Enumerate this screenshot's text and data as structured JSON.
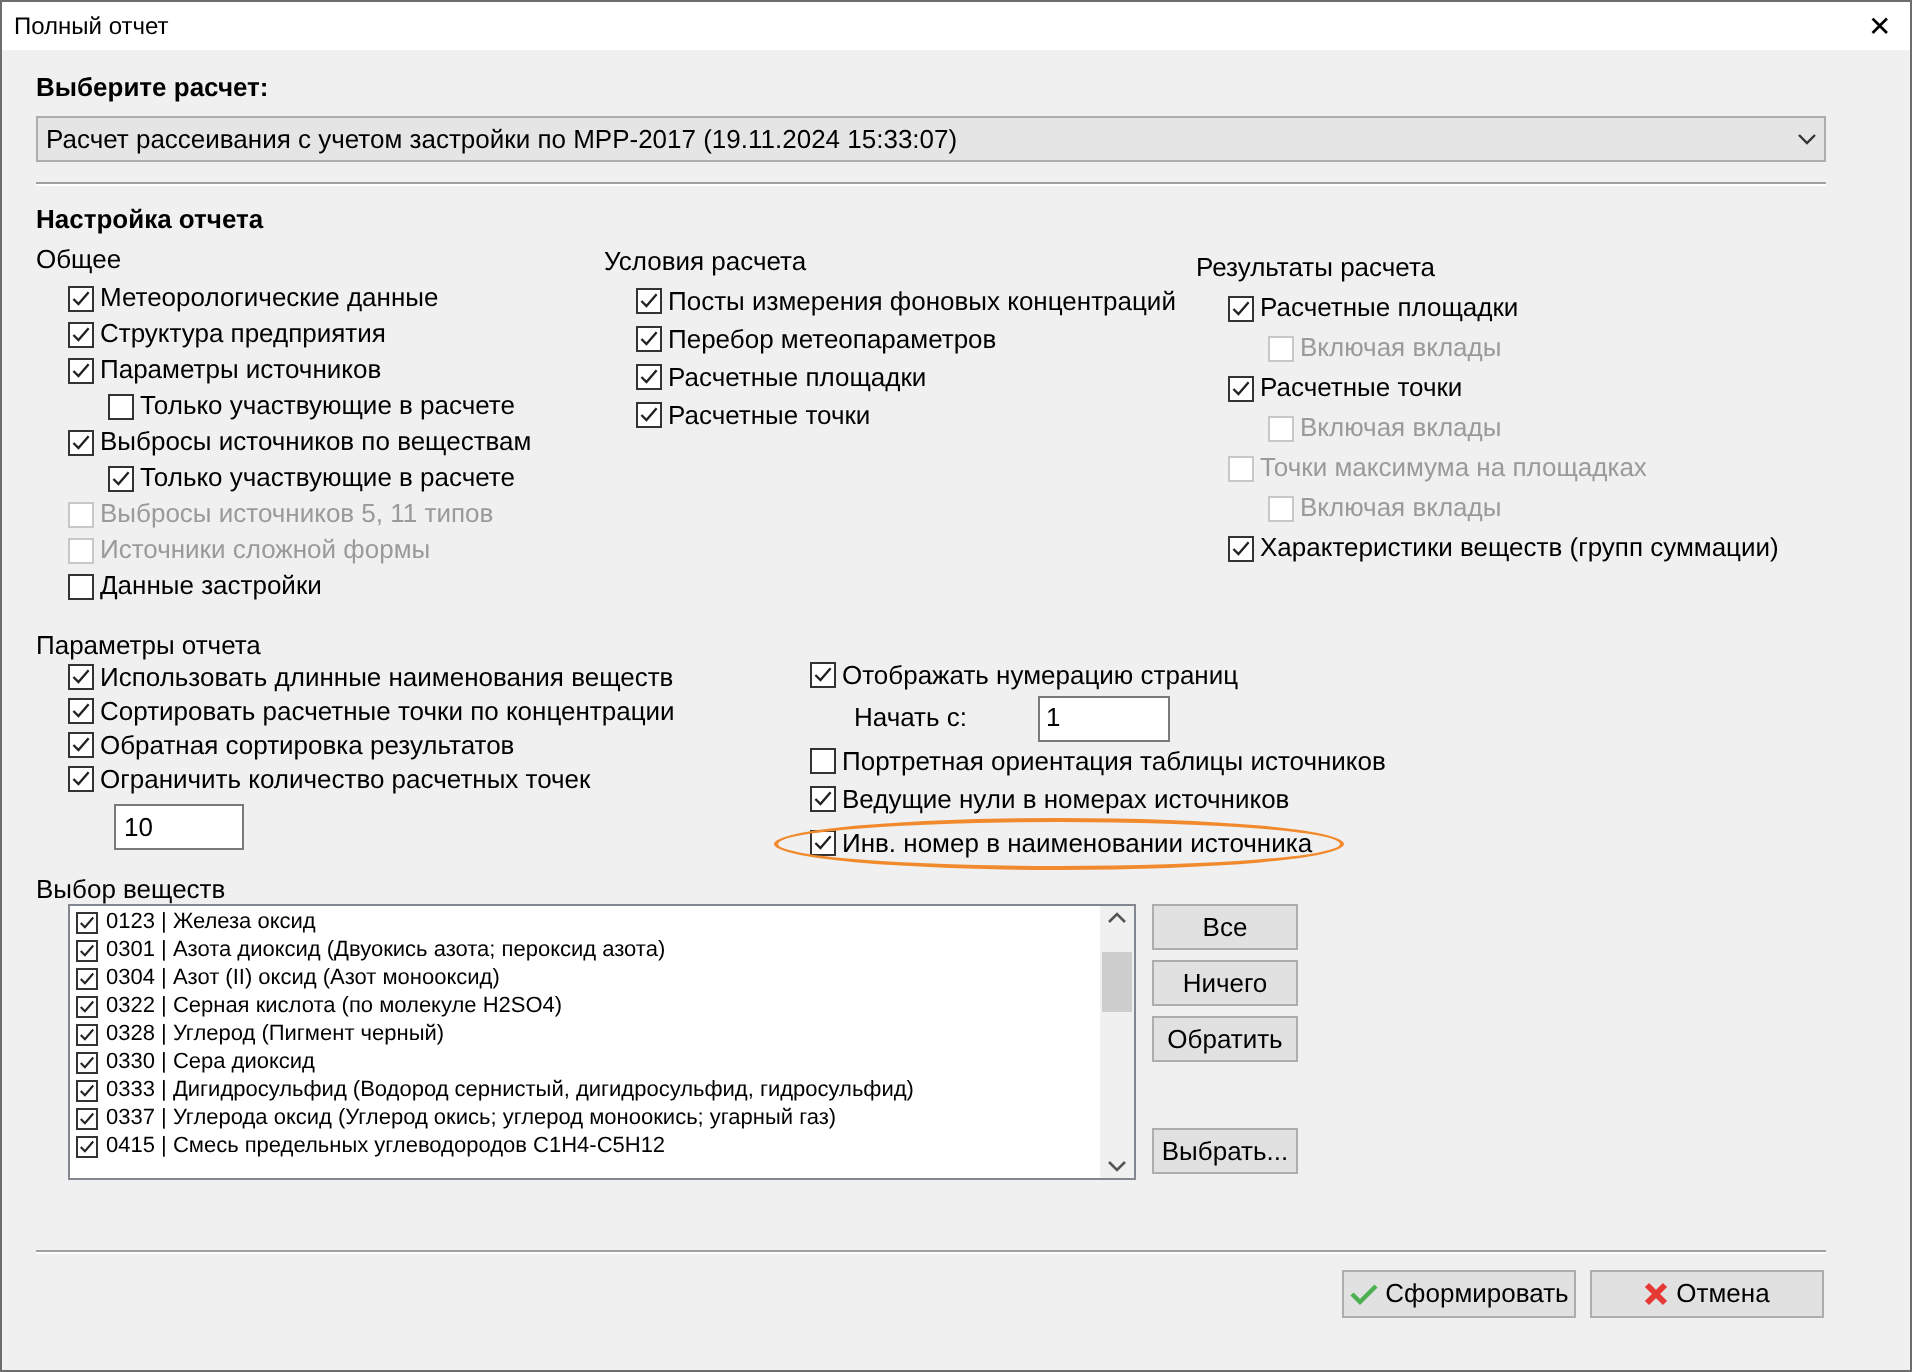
{
  "window": {
    "title": "Полный отчет",
    "close": "✕"
  },
  "calculation": {
    "label": "Выберите расчет:",
    "value": "Расчет рассеивания с учетом застройки по МРР-2017 (19.11.2024 15:33:07)"
  },
  "report_settings": {
    "title": "Настройка отчета",
    "groups": [
      {
        "title": "Общее",
        "items": [
          {
            "label": "Метеорологические данные",
            "checked": true,
            "disabled": false
          },
          {
            "label": "Структура предприятия",
            "checked": true,
            "disabled": false
          },
          {
            "label": "Параметры источников",
            "checked": true,
            "disabled": false,
            "children": [
              {
                "label": "Только участвующие в расчете",
                "checked": false,
                "disabled": false
              }
            ]
          },
          {
            "label": "Выбросы источников по веществам",
            "checked": true,
            "disabled": false,
            "children": [
              {
                "label": "Только участвующие в расчете",
                "checked": true,
                "disabled": false
              }
            ]
          },
          {
            "label": "Выбросы источников 5, 11 типов",
            "checked": false,
            "disabled": true
          },
          {
            "label": "Источники сложной формы",
            "checked": false,
            "disabled": true
          },
          {
            "label": "Данные застройки",
            "checked": false,
            "disabled": false
          }
        ]
      },
      {
        "title": "Условия расчета",
        "items": [
          {
            "label": "Посты измерения фоновых концентраций",
            "checked": true,
            "disabled": false
          },
          {
            "label": "Перебор метеопараметров",
            "checked": true,
            "disabled": false
          },
          {
            "label": "Расчетные площадки",
            "checked": true,
            "disabled": false
          },
          {
            "label": "Расчетные точки",
            "checked": true,
            "disabled": false
          }
        ]
      },
      {
        "title": "Результаты расчета",
        "items": [
          {
            "label": "Расчетные площадки",
            "checked": true,
            "disabled": false,
            "children": [
              {
                "label": "Включая вклады",
                "checked": false,
                "disabled": true
              }
            ]
          },
          {
            "label": "Расчетные точки",
            "checked": true,
            "disabled": false,
            "children": [
              {
                "label": "Включая вклады",
                "checked": false,
                "disabled": true
              }
            ]
          },
          {
            "label": "Точки максимума на площадках",
            "checked": false,
            "disabled": true,
            "children": [
              {
                "label": "Включая вклады",
                "checked": false,
                "disabled": true
              }
            ]
          },
          {
            "label": "Характеристики  веществ (групп суммации)",
            "checked": true,
            "disabled": false
          }
        ]
      }
    ]
  },
  "report_parameters": {
    "title": "Параметры отчета",
    "left_items": [
      {
        "kind": "checkbox",
        "label": "Использовать длинные наименования веществ",
        "checked": true
      },
      {
        "kind": "checkbox",
        "label": "Сортировать расчетные точки по концентрации",
        "checked": true
      },
      {
        "kind": "checkbox",
        "label": "Обратная сортировка результатов",
        "checked": true
      },
      {
        "kind": "checkbox",
        "label": "Ограничить количество расчетных точек",
        "checked": true
      },
      {
        "kind": "field",
        "value": "10"
      }
    ],
    "right_items": [
      {
        "kind": "checkbox",
        "label": "Отображать нумерацию страниц",
        "checked": true,
        "highlighted": false
      },
      {
        "kind": "field",
        "label": "Начать с:",
        "value": "1"
      },
      {
        "kind": "checkbox",
        "label": "Портретная ориентация таблицы источников",
        "checked": false,
        "highlighted": false
      },
      {
        "kind": "checkbox",
        "label": "Ведущие нули в номерах источников",
        "checked": true,
        "highlighted": false
      },
      {
        "kind": "checkbox",
        "label": "Инв. номер в наименовании источника",
        "checked": true,
        "highlighted": true
      }
    ]
  },
  "substances": {
    "title": "Выбор веществ",
    "items": [
      {
        "label": "0123 | Железа оксид",
        "checked": true
      },
      {
        "label": "0301 | Азота диоксид (Двуокись азота; пероксид азота)",
        "checked": true
      },
      {
        "label": "0304 | Азот (II) оксид (Азот монооксид)",
        "checked": true
      },
      {
        "label": "0322 | Серная кислота (по молекуле H2SO4)",
        "checked": true
      },
      {
        "label": "0328 | Углерод (Пигмент черный)",
        "checked": true
      },
      {
        "label": "0330 | Сера диоксид",
        "checked": true
      },
      {
        "label": "0333 | Дигидросульфид (Водород сернистый, дигидросульфид, гидросульфид)",
        "checked": true
      },
      {
        "label": "0337 | Углерода оксид (Углерод окись; углерод моноокись; угарный газ)",
        "checked": true
      },
      {
        "label": "0415 | Смесь предельных углеводородов C1H4-C5H12",
        "checked": true
      }
    ],
    "buttons": [
      "Все",
      "Ничего",
      "Обратить"
    ],
    "pick_button": "Выбрать..."
  },
  "footer_buttons": [
    {
      "kind": "ok",
      "label": "Сформировать"
    },
    {
      "kind": "cancel",
      "label": "Отмена"
    }
  ]
}
